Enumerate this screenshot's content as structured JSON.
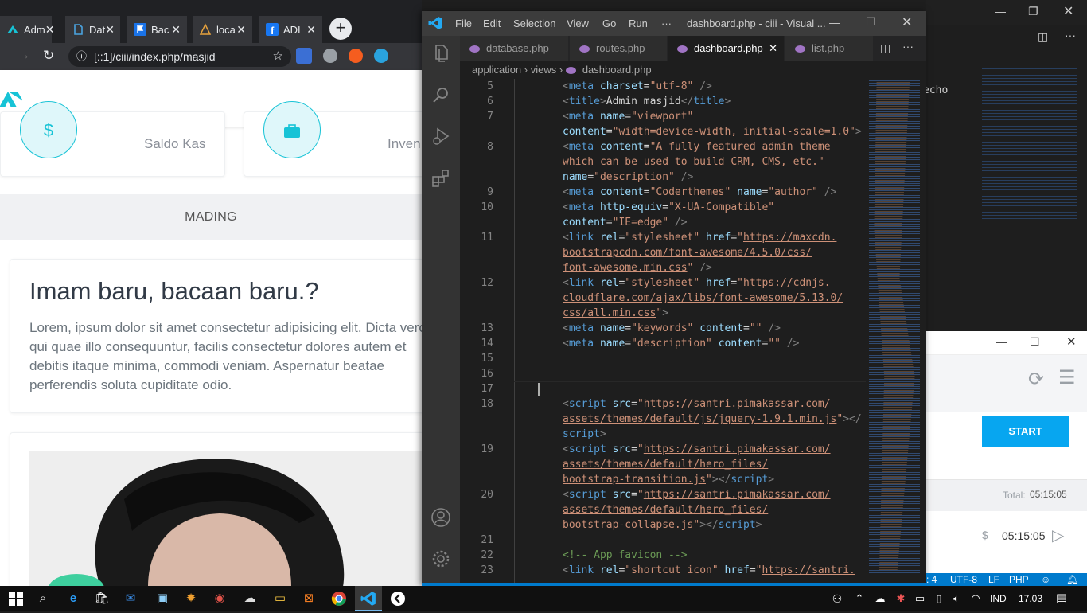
{
  "browser": {
    "tabs": [
      {
        "label": "Adm",
        "active": true
      },
      {
        "label": "Dat"
      },
      {
        "label": "Bac"
      },
      {
        "label": "loca"
      },
      {
        "label": "ADI"
      }
    ],
    "new_tab": "+",
    "url": "[::1]/ciii/index.php/masjid",
    "cards": [
      {
        "label": "Saldo Kas",
        "icon": "$"
      },
      {
        "label": "Inven"
      }
    ],
    "section_label": "MADING",
    "post": {
      "title": "Imam baru, bacaan baru.?",
      "body": "Lorem, ipsum dolor sit amet consectetur adipisicing elit. Dicta vero qui quae illo consequuntur, facilis consectetur dolores autem et debitis itaque minima, commodi veniam. Aspernatur beatae perferendis soluta cupiditate odio."
    }
  },
  "vscode": {
    "menu": [
      "File",
      "Edit",
      "Selection",
      "View",
      "Go",
      "Run",
      "···"
    ],
    "window_title": "dashboard.php - ciii - Visual ...",
    "tabs": [
      {
        "label": "database.php"
      },
      {
        "label": "routes.php"
      },
      {
        "label": "dashboard.php",
        "active": true
      },
      {
        "label": "list.php"
      }
    ],
    "breadcrumb": [
      "application",
      "views",
      "dashboard.php"
    ],
    "line_numbers": [
      "5",
      "6",
      "7",
      "8",
      "9",
      "10",
      "11",
      "12",
      "13",
      "14",
      "15",
      "16",
      "17",
      "18",
      "19",
      "20",
      "21",
      "22",
      "23"
    ]
  },
  "right_panel": {
    "background_text": "echo",
    "start_label": "START",
    "total_label": "Total:",
    "total_value": "05:15:05",
    "timer_value": "05:15:05",
    "currency_symbol": "$"
  },
  "status_bar": {
    "items": [
      ": 4",
      "UTF-8",
      "LF",
      "PHP"
    ]
  },
  "taskbar": {
    "language": "IND",
    "time": "17.03"
  },
  "colors": {
    "accent_cyan": "#17c3d6",
    "vscode_blue": "#007acc",
    "start_blue": "#07a6f0"
  }
}
